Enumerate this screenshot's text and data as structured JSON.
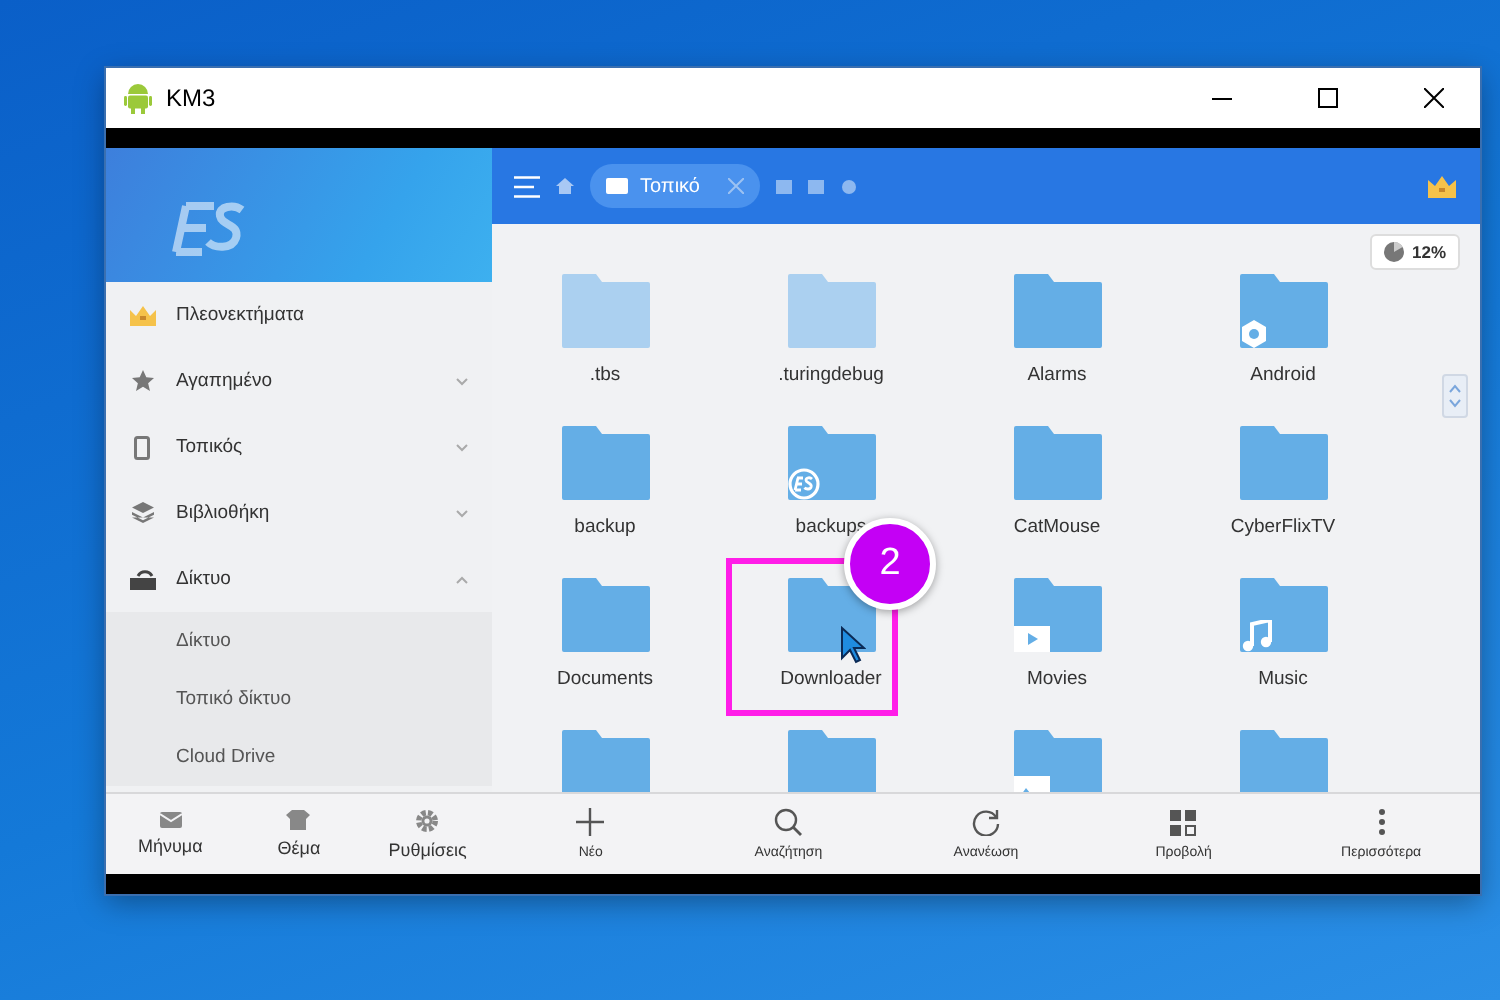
{
  "window": {
    "title": "KM3"
  },
  "sidebar": {
    "items": [
      {
        "label": "Πλεονεκτήματα",
        "kind": "premium"
      },
      {
        "label": "Αγαπημένο",
        "kind": "favorites",
        "expanded": false
      },
      {
        "label": "Τοπικός",
        "kind": "local",
        "expanded": false
      },
      {
        "label": "Βιβλιοθήκη",
        "kind": "library",
        "expanded": false
      },
      {
        "label": "Δίκτυο",
        "kind": "network",
        "expanded": true,
        "children": [
          {
            "label": "Δίκτυο"
          },
          {
            "label": "Τοπικό δίκτυο"
          },
          {
            "label": "Cloud Drive"
          }
        ]
      }
    ],
    "footer": [
      {
        "label": "Μήνυμα",
        "kind": "message"
      },
      {
        "label": "Θέμα",
        "kind": "theme"
      },
      {
        "label": "Ρυθμίσεις",
        "kind": "settings"
      }
    ]
  },
  "topbar": {
    "tab": {
      "label": "Τοπικό"
    }
  },
  "storage": {
    "reading": "12%"
  },
  "folders": [
    {
      "label": ".tbs",
      "hidden": true,
      "kind": "plain",
      "highlighted": false
    },
    {
      "label": ".turingdebug",
      "hidden": true,
      "kind": "plain",
      "highlighted": false
    },
    {
      "label": "Alarms",
      "hidden": false,
      "kind": "plain",
      "highlighted": false
    },
    {
      "label": "Android",
      "hidden": false,
      "kind": "gear",
      "highlighted": false
    },
    {
      "label": "backup",
      "hidden": false,
      "kind": "plain",
      "highlighted": false
    },
    {
      "label": "backups",
      "hidden": false,
      "kind": "es",
      "highlighted": false
    },
    {
      "label": "CatMouse",
      "hidden": false,
      "kind": "plain",
      "highlighted": false
    },
    {
      "label": "CyberFlixTV",
      "hidden": false,
      "kind": "plain",
      "highlighted": false
    },
    {
      "label": "Documents",
      "hidden": false,
      "kind": "plain",
      "highlighted": false
    },
    {
      "label": "Downloader",
      "hidden": false,
      "kind": "plain",
      "highlighted": true
    },
    {
      "label": "Movies",
      "hidden": false,
      "kind": "play",
      "highlighted": false
    },
    {
      "label": "Music",
      "hidden": false,
      "kind": "music",
      "highlighted": false
    },
    {
      "hidden": false,
      "kind": "plain",
      "highlighted": false
    },
    {
      "hidden": false,
      "kind": "plain",
      "highlighted": false
    },
    {
      "hidden": false,
      "kind": "image",
      "highlighted": false
    },
    {
      "hidden": false,
      "kind": "plain",
      "highlighted": false
    }
  ],
  "annotation": {
    "step": "2"
  },
  "bottom_bar": [
    {
      "label": "Νέο",
      "kind": "new"
    },
    {
      "label": "Αναζήτηση",
      "kind": "search"
    },
    {
      "label": "Ανανέωση",
      "kind": "refresh"
    },
    {
      "label": "Προβολή",
      "kind": "view"
    },
    {
      "label": "Περισσότερα",
      "kind": "more"
    }
  ]
}
